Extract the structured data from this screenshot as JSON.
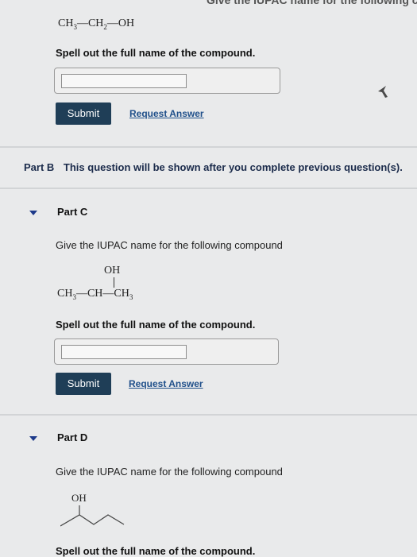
{
  "partA": {
    "formula": {
      "c1": "CH",
      "s1": "3",
      "c2": "CH",
      "s2": "2",
      "c3": "OH"
    },
    "prompt": "Spell out the full name of the compound.",
    "input_value": "",
    "submit_label": "Submit",
    "request_label": "Request Answer"
  },
  "partB": {
    "label": "Part B",
    "message": "This question will be shown after you complete previous question(s)."
  },
  "partC": {
    "title": "Part C",
    "question": "Give the IUPAC name for the following compound",
    "formula": {
      "oh": "OH",
      "c1": "CH",
      "s1": "3",
      "c2": "CH",
      "c3": "CH",
      "s3": "3"
    },
    "prompt": "Spell out the full name of the compound.",
    "input_value": "",
    "submit_label": "Submit",
    "request_label": "Request Answer"
  },
  "partD": {
    "title": "Part D",
    "question": "Give the IUPAC name for the following compound",
    "structure_label": "OH",
    "prompt": "Spell out the full name of the compound."
  },
  "colors": {
    "background": "#e9eaeb",
    "submit_button": "#1f3e57",
    "link": "#1f4f8a",
    "part_b_text": "#1b2b4b",
    "caret": "#1d3a8a"
  },
  "icons": [
    "caret-down-icon",
    "mouse-cursor-icon",
    "vertical-bond-icon",
    "skeletal-structure-icon"
  ]
}
